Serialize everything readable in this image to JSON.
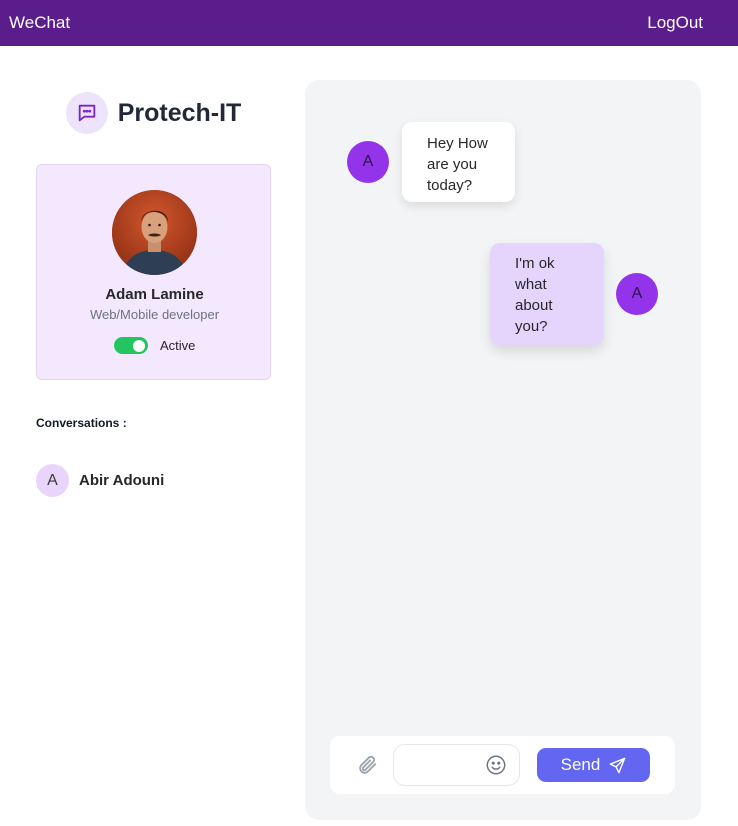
{
  "topbar": {
    "brand": "WeChat",
    "logout_label": "LogOut",
    "color": "#5b1d8c"
  },
  "sidebar": {
    "logo_title": "Protech-IT",
    "logo_icon": "chat-bubble-icon",
    "profile": {
      "name": "Adam Lamine",
      "role": "Web/Mobile developer",
      "status_label": "Active",
      "status_on": true
    },
    "conversations_title": "Conversations :",
    "conversations": [
      {
        "initial": "A",
        "name": "Abir Adouni"
      }
    ]
  },
  "chat": {
    "messages": [
      {
        "direction": "incoming",
        "avatar_initial": "A",
        "text": "Hey How are you today?"
      },
      {
        "direction": "outgoing",
        "avatar_initial": "A",
        "text": "I'm ok what about you?"
      }
    ],
    "composer": {
      "input_value": "",
      "send_label": "Send",
      "send_color": "#6366f1"
    }
  },
  "colors": {
    "accent": "#9333ea",
    "panel_bg": "#f3f4f6",
    "status_green": "#22c55e"
  }
}
